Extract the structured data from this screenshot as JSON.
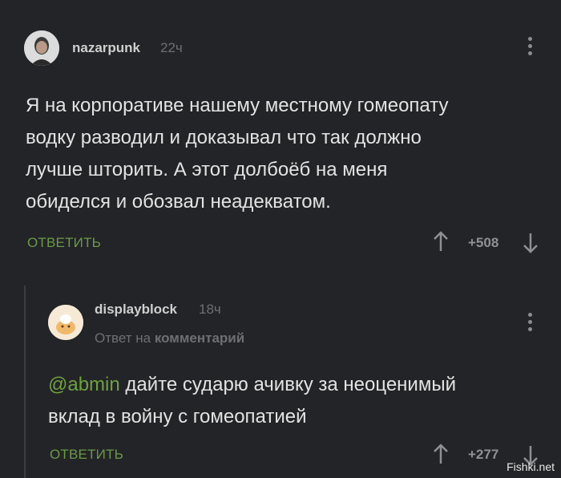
{
  "comment1": {
    "username": "nazarpunk",
    "time": "22ч",
    "lines": [
      "Я на корпоративе нашему местному гомеопату",
      "водку разводил и доказывал что так должно",
      "лучше шторить. А этот долбоёб на меня",
      "обиделся и обозвал неадекватом."
    ],
    "reply_label": "ОТВЕТИТЬ",
    "score": "+508"
  },
  "comment2": {
    "username": "displayblock",
    "time": "18ч",
    "reply_to_prefix": "Ответ на",
    "reply_to_link": "комментарий",
    "mention": "@abmin",
    "line1_rest": " дайте сударю ачивку за неоценимый",
    "line2": "вклад в войну с гомеопатией",
    "reply_label": "ОТВЕТИТЬ",
    "score": "+277"
  },
  "watermark": "Fishki.net"
}
